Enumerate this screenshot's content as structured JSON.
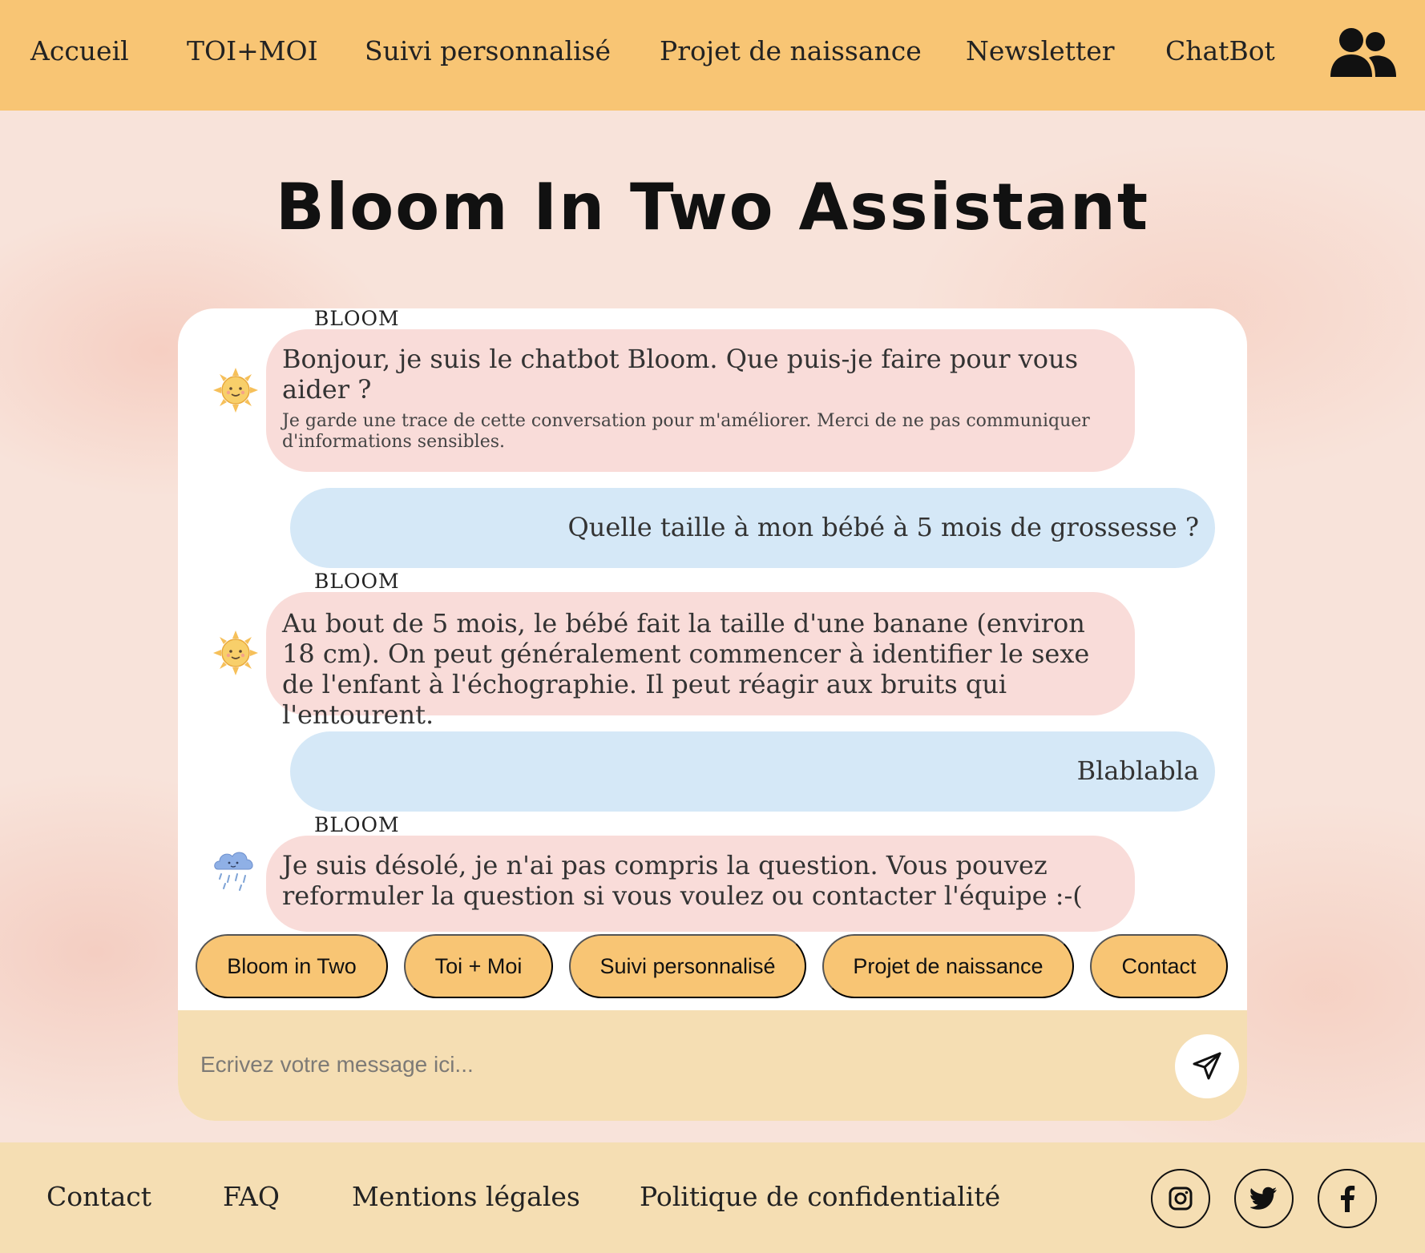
{
  "nav": {
    "items": [
      "Accueil",
      "TOI+MOI",
      "Suivi personnalisé",
      "Projet de naissance",
      "Newsletter",
      "ChatBot"
    ],
    "account_icon": "users-icon"
  },
  "title": "Bloom In Two Assistant",
  "chat": {
    "messages": [
      {
        "from": "bot",
        "sender": "BLOOM",
        "avatar": "sun-icon",
        "text": "Bonjour, je suis le chatbot Bloom. Que puis-je faire pour vous aider ?",
        "note": "Je garde une trace de cette conversation pour m'améliorer. Merci de ne pas communiquer d'informations sensibles."
      },
      {
        "from": "user",
        "text": "Quelle taille à mon bébé à 5 mois de grossesse ?"
      },
      {
        "from": "bot",
        "sender": "BLOOM",
        "avatar": "sun-icon",
        "text": "Au bout de 5 mois, le bébé fait la taille d'une banane (environ 18 cm). On peut généralement commencer à identifier le sexe de l'enfant à l'échographie. Il peut réagir aux bruits qui l'entourent."
      },
      {
        "from": "user",
        "text": "Blablabla"
      },
      {
        "from": "bot",
        "sender": "BLOOM",
        "avatar": "rain-cloud-icon",
        "text": "Je suis désolé, je n'ai pas compris la question. Vous pouvez reformuler la question si vous voulez ou contacter l'équipe :-("
      }
    ],
    "quick_replies": [
      "Bloom in Two",
      "Toi + Moi",
      "Suivi personnalisé",
      "Projet de naissance",
      "Contact"
    ],
    "input_placeholder": "Ecrivez votre message ici...",
    "send_icon": "send-icon"
  },
  "footer": {
    "links": [
      "Contact",
      "FAQ",
      "Mentions légales",
      "Politique de confidentialité"
    ],
    "social_icons": [
      "instagram-icon",
      "twitter-icon",
      "facebook-icon"
    ]
  },
  "colors": {
    "nav_bg": "#f8c574",
    "bot_bubble": "#f9dcd9",
    "user_bubble": "#d5e8f7",
    "quick_reply": "#f8c574",
    "input_bar": "#f5deb3",
    "footer_bg": "#f5deb3"
  }
}
